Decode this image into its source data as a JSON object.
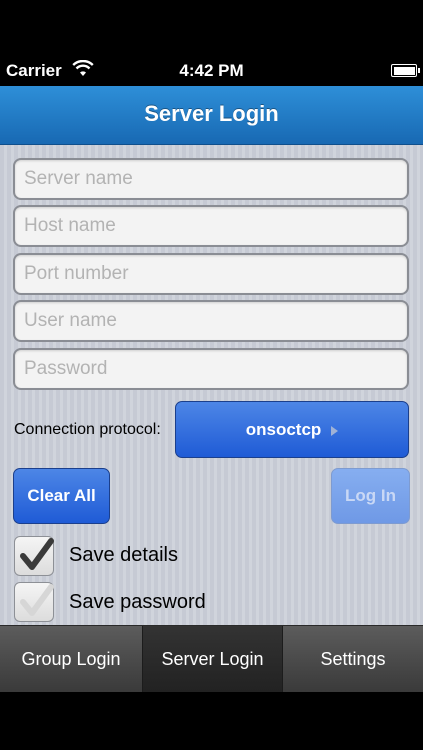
{
  "status_bar": {
    "carrier": "Carrier",
    "time": "4:42 PM",
    "wifi_icon": "wifi-icon",
    "battery_icon": "battery-icon"
  },
  "nav": {
    "title": "Server Login"
  },
  "form": {
    "server_name": {
      "placeholder": "Server name",
      "value": ""
    },
    "host_name": {
      "placeholder": "Host name",
      "value": ""
    },
    "port_number": {
      "placeholder": "Port number",
      "value": ""
    },
    "user_name": {
      "placeholder": "User name",
      "value": ""
    },
    "password": {
      "placeholder": "Password",
      "value": ""
    },
    "protocol_label": "Connection protocol:",
    "protocol_value": "onsoctcp"
  },
  "buttons": {
    "clear_all": "Clear All",
    "log_in": "Log In"
  },
  "checkboxes": {
    "save_details": {
      "label": "Save details",
      "checked": true
    },
    "save_password": {
      "label": "Save password",
      "checked": false
    }
  },
  "tabs": [
    {
      "label": "Group Login",
      "selected": false
    },
    {
      "label": "Server Login",
      "selected": true
    },
    {
      "label": "Settings",
      "selected": false
    }
  ],
  "colors": {
    "nav_blue": "#1f7cc9",
    "button_blue": "#2a66dc",
    "disabled_blue": "#7aa3ea",
    "tab_bar": "#474747"
  }
}
